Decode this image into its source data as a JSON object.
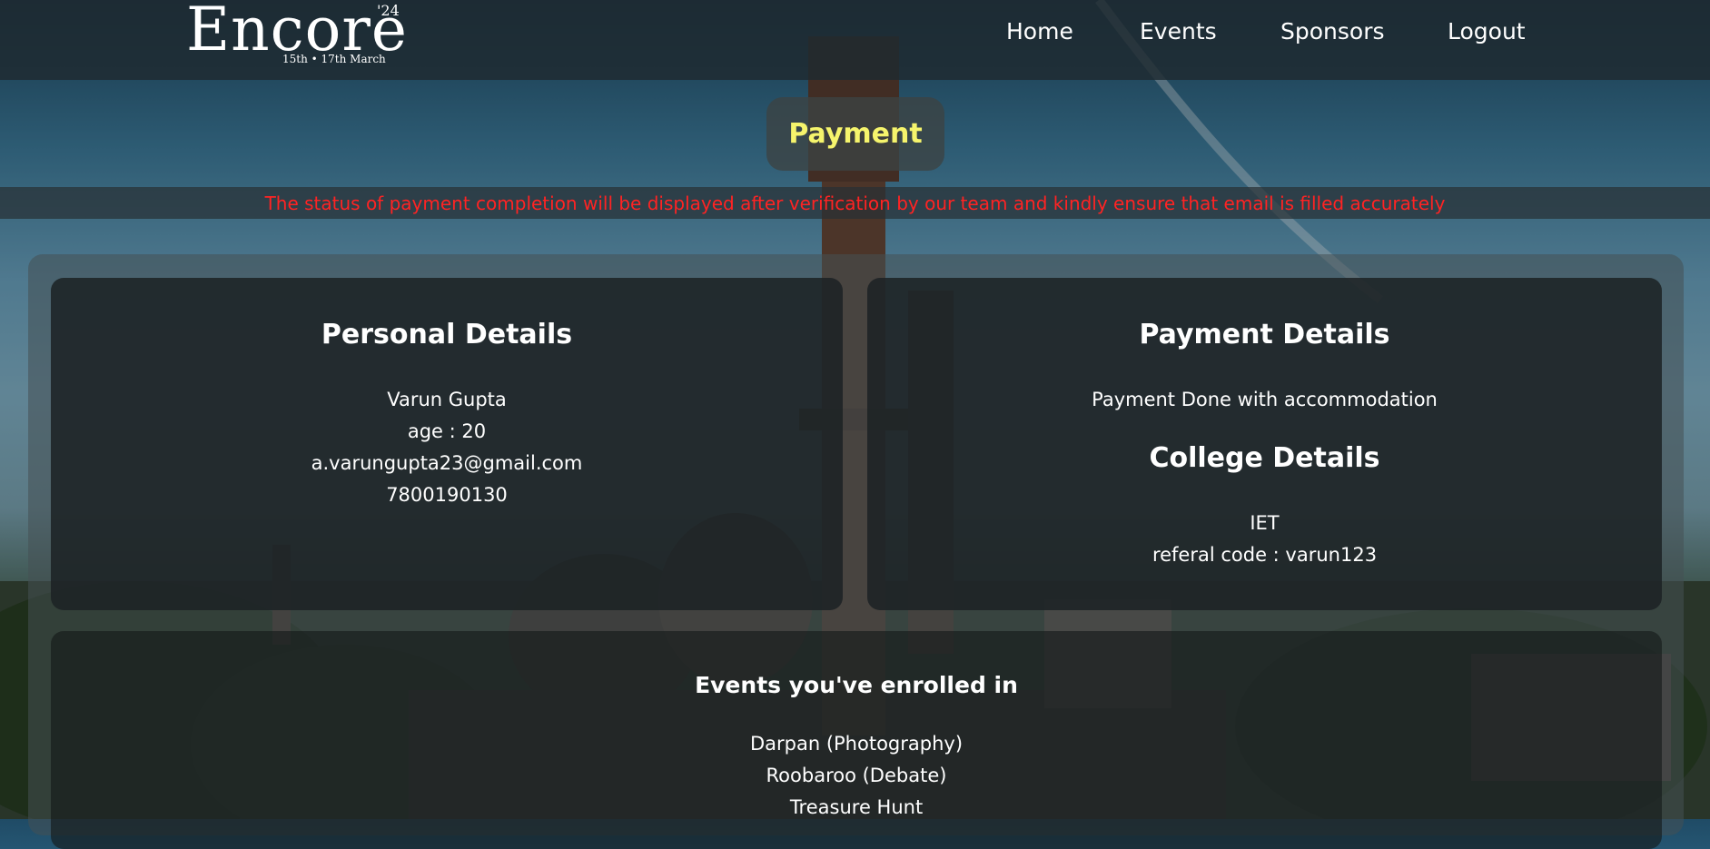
{
  "header": {
    "logo": {
      "word": "Encore",
      "year": "'24",
      "dates": "15th • 17th March"
    },
    "nav": [
      {
        "label": "Home"
      },
      {
        "label": "Events"
      },
      {
        "label": "Sponsors"
      },
      {
        "label": "Logout"
      }
    ]
  },
  "page": {
    "title": "Payment",
    "notice": "The status of payment completion will be displayed after verification by our team and kindly ensure that email is filled accurately"
  },
  "personal": {
    "heading": "Personal Details",
    "name": "Varun Gupta",
    "age": "age : 20",
    "email": "a.varungupta23@gmail.com",
    "phone": "7800190130"
  },
  "payment": {
    "heading": "Payment Details",
    "status": "Payment Done with accommodation"
  },
  "college": {
    "heading": "College Details",
    "name": "IET",
    "referral": "referal code : varun123"
  },
  "events": {
    "heading": "Events you've enrolled in",
    "items": [
      "Darpan (Photography)",
      "Roobaroo (Debate)",
      "Treasure Hunt"
    ]
  },
  "colors": {
    "title": "#f6f46c",
    "notice": "#ff2323",
    "text": "#ffffff"
  }
}
